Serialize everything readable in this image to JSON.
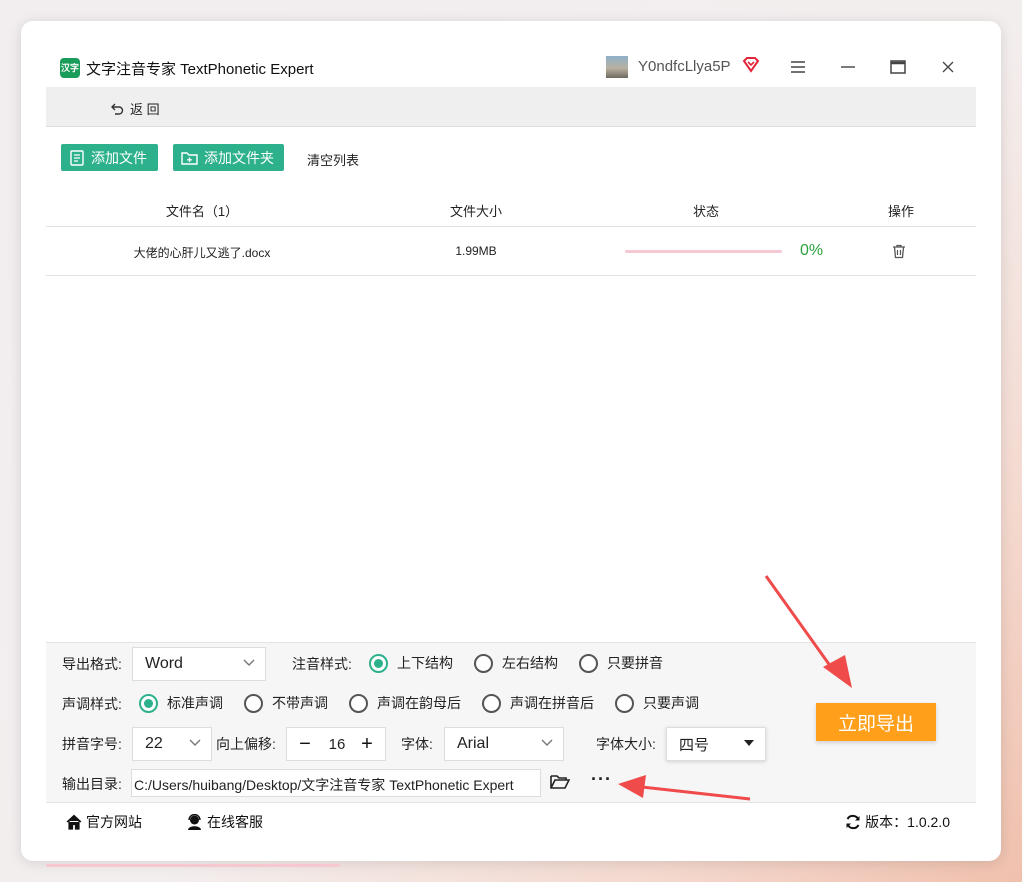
{
  "window": {
    "app_title": "文字注音专家 TextPhonetic Expert",
    "app_logo_text": "汉字",
    "username": "Y0ndfcLlya5P",
    "icons": [
      "menu-icon",
      "minimize-icon",
      "maximize-icon",
      "close-icon"
    ]
  },
  "nav": {
    "back_label": "返 回"
  },
  "toolbar": {
    "add_file": "添加文件",
    "add_folder": "添加文件夹",
    "clear_list": "清空列表"
  },
  "table": {
    "headers": {
      "name": "文件名（1）",
      "size": "文件大小",
      "status": "状态",
      "ops": "操作"
    },
    "rows": [
      {
        "name": "大佬的心肝儿又逃了.docx",
        "size": "1.99MB",
        "progress": 0,
        "progress_text": "0%"
      }
    ]
  },
  "settings": {
    "export_format_label": "导出格式:",
    "export_format_value": "Word",
    "annotation_style_label": "注音样式:",
    "annotation_options": [
      "上下结构",
      "左右结构",
      "只要拼音"
    ],
    "annotation_selected": 0,
    "tone_style_label": "声调样式:",
    "tone_options": [
      "标准声调",
      "不带声调",
      "声调在韵母后",
      "声调在拼音后",
      "只要声调"
    ],
    "tone_selected": 0,
    "pinyin_size_label": "拼音字号:",
    "pinyin_size_value": "22",
    "offset_label": "向上偏移:",
    "offset_value": "16",
    "font_label": "字体:",
    "font_value": "Arial",
    "font_size_label": "字体大小:",
    "font_size_value": "四号",
    "output_dir_label": "输出目录:",
    "output_dir_value": "C:/Users/huibang/Desktop/文字注音专家 TextPhonetic Expert",
    "more_label": "···"
  },
  "export_button": "立即导出",
  "footer": {
    "website": "官方网站",
    "support": "在线客服",
    "version": "版本：1.0.2.0"
  },
  "colors": {
    "accent": "#2db18c",
    "export": "#ff9f1a",
    "annotation_arrow": "#ef4b4b",
    "progress_track": "#f5c9d3"
  }
}
